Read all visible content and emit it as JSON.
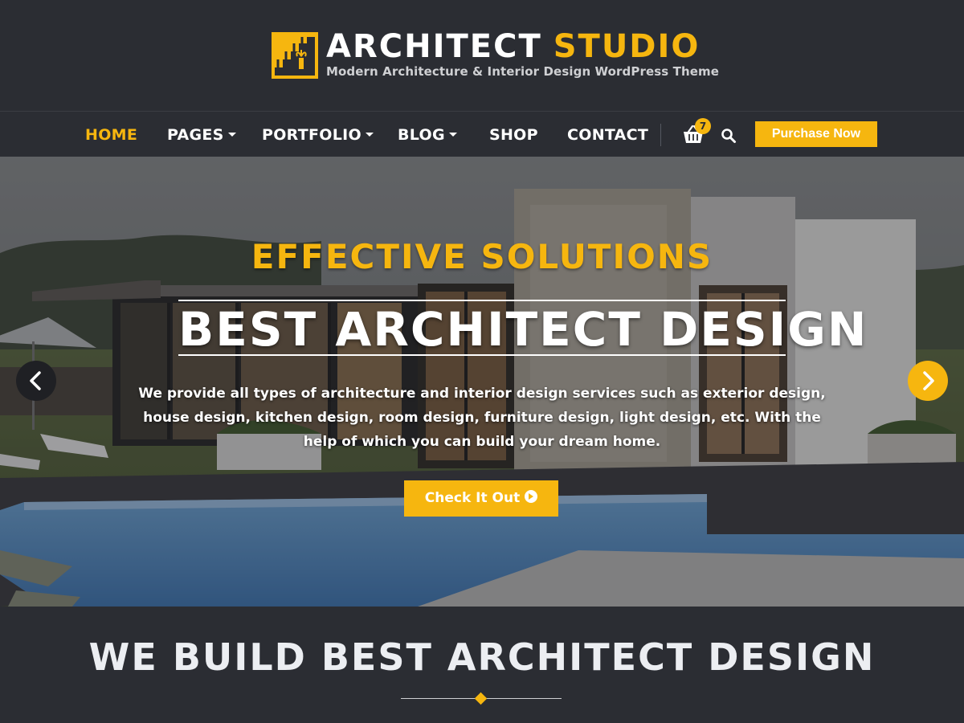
{
  "brand": {
    "name_part1": "ARCHITECT",
    "name_part2": "STUDIO",
    "tagline": "Modern Architecture & Interior Design WordPress Theme",
    "logo_icon": "staircase-building-icon"
  },
  "colors": {
    "accent": "#f6b60f",
    "header_bg": "#2b2d33",
    "text": "#ffffff"
  },
  "nav": {
    "items": [
      {
        "label": "HOME",
        "active": true,
        "has_dropdown": false
      },
      {
        "label": "PAGES",
        "active": false,
        "has_dropdown": true
      },
      {
        "label": "PORTFOLIO",
        "active": false,
        "has_dropdown": true
      },
      {
        "label": "BLOG",
        "active": false,
        "has_dropdown": true
      },
      {
        "label": "SHOP",
        "active": false,
        "has_dropdown": false
      },
      {
        "label": "CONTACT",
        "active": false,
        "has_dropdown": false
      }
    ],
    "cart_icon": "shopping-basket-icon",
    "cart_count": "7",
    "search_icon": "search-icon",
    "purchase_label": "Purchase Now"
  },
  "hero": {
    "eyebrow": "EFFECTIVE SOLUTIONS",
    "title": "BEST ARCHITECT DESIGN",
    "description": "We provide all types of architecture and interior design services such as exterior design, house design, kitchen design, room design, furniture design, light design, etc. With the help of which you can build your dream home.",
    "cta_label": "Check It Out",
    "cta_icon": "chevron-circle-right-icon",
    "prev_icon": "chevron-left-icon",
    "next_icon": "chevron-right-icon"
  },
  "section": {
    "title": "WE BUILD BEST ARCHITECT DESIGN",
    "divider_icon": "diamond-icon"
  }
}
